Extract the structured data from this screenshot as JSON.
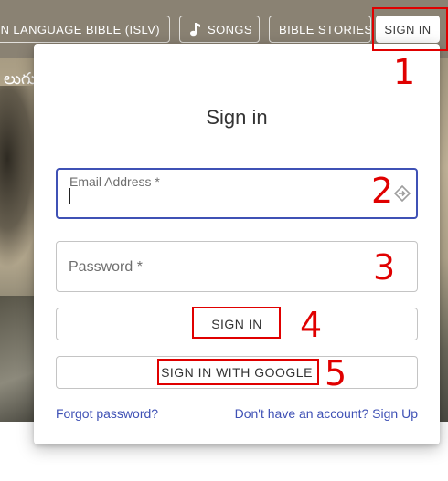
{
  "nav": {
    "islv_label": "SIGN LANGUAGE BIBLE (ISLV)",
    "songs_label": "SONGS",
    "songs_icon": "music-note-icon",
    "stories_label": "BIBLE STORIES",
    "signin_label": "SIGN IN"
  },
  "hero": {
    "text": "లుగు"
  },
  "dialog": {
    "title": "Sign in",
    "email_label": "Email Address *",
    "email_value": "",
    "email_icon": "autofill-icon",
    "password_label": "Password *",
    "password_value": "",
    "signin_button": "SIGN IN",
    "google_button": "SIGN IN WITH GOOGLE",
    "forgot_link": "Forgot password?",
    "signup_link": "Don't have an account? Sign Up"
  },
  "annotations": [
    "1",
    "2",
    "3",
    "4",
    "5"
  ],
  "colors": {
    "topbar": "#8a8273",
    "accent": "#3f51b5",
    "annotation": "#e00000"
  }
}
